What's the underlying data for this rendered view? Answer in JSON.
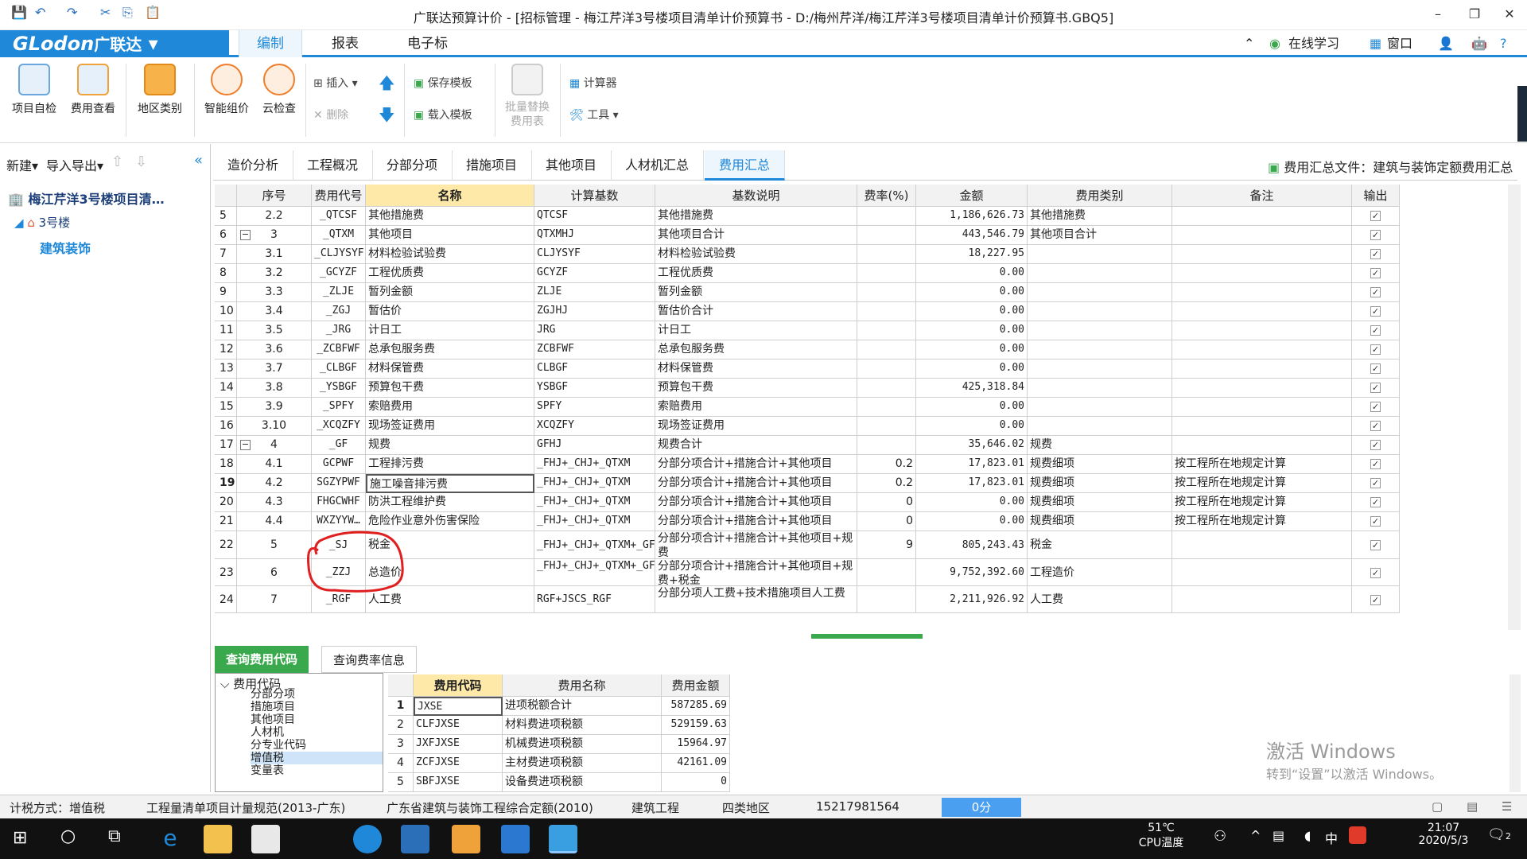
{
  "window": {
    "title": "广联达预算计价 - [招标管理 - 梅江芹洋3号楼项目清单计价预算书 - D:/梅州芹洋/梅江芹洋3号楼项目清单计价预算书.GBQ5]",
    "minimize": "–",
    "restore": "❐",
    "close": "✕"
  },
  "menubar": {
    "logo": "GLodon",
    "logo_cn": "广联达",
    "tabs": [
      "编制",
      "报表",
      "电子标"
    ],
    "right": {
      "online": "在线学习",
      "window": "窗口",
      "help": "?"
    }
  },
  "ribbon": {
    "buttons": [
      "项目自检",
      "费用查看",
      "地区类别",
      "智能组价",
      "云检查"
    ],
    "insert": "插入",
    "delete": "删除",
    "save_template": "保存模板",
    "load_template": "载入模板",
    "batch_replace": "批量替换费用表",
    "calculator": "计算器",
    "tools": "工具"
  },
  "left": {
    "new": "新建",
    "import_export": "导入导出",
    "project": "梅江芹洋3号楼项目清…",
    "building": "3号楼",
    "unit": "建筑装饰"
  },
  "tabs": [
    "造价分析",
    "工程概况",
    "分部分项",
    "措施项目",
    "其他项目",
    "人材机汇总",
    "费用汇总"
  ],
  "tabs_right": "费用汇总文件：建筑与装饰定额费用汇总",
  "grid": {
    "headers": [
      "序号",
      "费用代号",
      "名称",
      "计算基数",
      "基数说明",
      "费率(%)",
      "金额",
      "费用类别",
      "备注",
      "输出"
    ],
    "rows": [
      {
        "r": "5",
        "seq": "2.2",
        "code": "_QTCSF",
        "name": "其他措施费",
        "base": "QTCSF",
        "desc": "其他措施费",
        "rate": "",
        "amt": "1,186,626.73",
        "cat": "其他措施费",
        "note": ""
      },
      {
        "r": "6",
        "seq": "3",
        "code": "_QTXM",
        "name": "其他项目",
        "base": "QTXMHJ",
        "desc": "其他项目合计",
        "rate": "",
        "amt": "443,546.79",
        "cat": "其他项目合计",
        "note": ""
      },
      {
        "r": "7",
        "seq": "3.1",
        "code": "_CLJYSYF",
        "name": "材料检验试验费",
        "base": "CLJYSYF",
        "desc": "材料检验试验费",
        "rate": "",
        "amt": "18,227.95",
        "cat": "",
        "note": ""
      },
      {
        "r": "8",
        "seq": "3.2",
        "code": "_GCYZF",
        "name": "工程优质费",
        "base": "GCYZF",
        "desc": "工程优质费",
        "rate": "",
        "amt": "0.00",
        "cat": "",
        "note": ""
      },
      {
        "r": "9",
        "seq": "3.3",
        "code": "_ZLJE",
        "name": "暂列金额",
        "base": "ZLJE",
        "desc": "暂列金额",
        "rate": "",
        "amt": "0.00",
        "cat": "",
        "note": ""
      },
      {
        "r": "10",
        "seq": "3.4",
        "code": "_ZGJ",
        "name": "暂估价",
        "base": "ZGJHJ",
        "desc": "暂估价合计",
        "rate": "",
        "amt": "0.00",
        "cat": "",
        "note": ""
      },
      {
        "r": "11",
        "seq": "3.5",
        "code": "_JRG",
        "name": "计日工",
        "base": "JRG",
        "desc": "计日工",
        "rate": "",
        "amt": "0.00",
        "cat": "",
        "note": ""
      },
      {
        "r": "12",
        "seq": "3.6",
        "code": "_ZCBFWF",
        "name": "总承包服务费",
        "base": "ZCBFWF",
        "desc": "总承包服务费",
        "rate": "",
        "amt": "0.00",
        "cat": "",
        "note": ""
      },
      {
        "r": "13",
        "seq": "3.7",
        "code": "_CLBGF",
        "name": "材料保管费",
        "base": "CLBGF",
        "desc": "材料保管费",
        "rate": "",
        "amt": "0.00",
        "cat": "",
        "note": ""
      },
      {
        "r": "14",
        "seq": "3.8",
        "code": "_YSBGF",
        "name": "预算包干费",
        "base": "YSBGF",
        "desc": "预算包干费",
        "rate": "",
        "amt": "425,318.84",
        "cat": "",
        "note": ""
      },
      {
        "r": "15",
        "seq": "3.9",
        "code": "_SPFY",
        "name": "索赔费用",
        "base": "SPFY",
        "desc": "索赔费用",
        "rate": "",
        "amt": "0.00",
        "cat": "",
        "note": ""
      },
      {
        "r": "16",
        "seq": "3.10",
        "code": "_XCQZFY",
        "name": "现场签证费用",
        "base": "XCQZFY",
        "desc": "现场签证费用",
        "rate": "",
        "amt": "0.00",
        "cat": "",
        "note": ""
      },
      {
        "r": "17",
        "seq": "4",
        "code": "_GF",
        "name": "规费",
        "base": "GFHJ",
        "desc": "规费合计",
        "rate": "",
        "amt": "35,646.02",
        "cat": "规费",
        "note": ""
      },
      {
        "r": "18",
        "seq": "4.1",
        "code": "GCPWF",
        "name": "工程排污费",
        "base": "_FHJ+_CHJ+_QTXM",
        "desc": "分部分项合计+措施合计+其他项目",
        "rate": "0.2",
        "amt": "17,823.01",
        "cat": "规费细项",
        "note": "按工程所在地规定计算"
      },
      {
        "r": "19",
        "seq": "4.2",
        "code": "SGZYPWF",
        "name": "施工噪音排污费",
        "base": "_FHJ+_CHJ+_QTXM",
        "desc": "分部分项合计+措施合计+其他项目",
        "rate": "0.2",
        "amt": "17,823.01",
        "cat": "规费细项",
        "note": "按工程所在地规定计算"
      },
      {
        "r": "20",
        "seq": "4.3",
        "code": "FHGCWHF",
        "name": "防洪工程维护费",
        "base": "_FHJ+_CHJ+_QTXM",
        "desc": "分部分项合计+措施合计+其他项目",
        "rate": "0",
        "amt": "0.00",
        "cat": "规费细项",
        "note": "按工程所在地规定计算"
      },
      {
        "r": "21",
        "seq": "4.4",
        "code": "WXZYYW…",
        "name": "危险作业意外伤害保险",
        "base": "_FHJ+_CHJ+_QTXM",
        "desc": "分部分项合计+措施合计+其他项目",
        "rate": "0",
        "amt": "0.00",
        "cat": "规费细项",
        "note": "按工程所在地规定计算"
      },
      {
        "r": "22",
        "seq": "5",
        "code": "_SJ",
        "name": "税金",
        "base": "_FHJ+_CHJ+_QTXM+_GF",
        "desc": "分部分项合计+措施合计+其他项目+规费",
        "rate": "9",
        "amt": "805,243.43",
        "cat": "税金",
        "note": ""
      },
      {
        "r": "23",
        "seq": "6",
        "code": "_ZZJ",
        "name": "总造价",
        "base": "_FHJ+_CHJ+_QTXM+_GF+_SJ",
        "desc": "分部分项合计+措施合计+其他项目+规费+税金",
        "rate": "",
        "amt": "9,752,392.60",
        "cat": "工程造价",
        "note": ""
      },
      {
        "r": "24",
        "seq": "7",
        "code": "_RGF",
        "name": "人工费",
        "base": "RGF+JSCS_RGF",
        "desc": "分部分项人工费+技术措施项目人工费",
        "rate": "",
        "amt": "2,211,926.92",
        "cat": "人工费",
        "note": ""
      }
    ]
  },
  "bottom": {
    "tabs": [
      "查询费用代码",
      "查询费率信息"
    ],
    "tree_root": "费用代码",
    "tree_items": [
      "分部分项",
      "措施项目",
      "其他项目",
      "人材机",
      "分专业代码",
      "增值税",
      "变量表"
    ],
    "headers": [
      "费用代码",
      "费用名称",
      "费用金额"
    ],
    "rows": [
      {
        "n": "1",
        "code": "JXSE",
        "name": "进项税额合计",
        "amt": "587285.69"
      },
      {
        "n": "2",
        "code": "CLFJXSE",
        "name": "材料费进项税额",
        "amt": "529159.63"
      },
      {
        "n": "3",
        "code": "JXFJXSE",
        "name": "机械费进项税额",
        "amt": "15964.97"
      },
      {
        "n": "4",
        "code": "ZCFJXSE",
        "name": "主材费进项税额",
        "amt": "42161.09"
      },
      {
        "n": "5",
        "code": "SBFJXSE",
        "name": "设备费进项税额",
        "amt": "0"
      }
    ]
  },
  "watermark": {
    "line1": "激活 Windows",
    "line2": "转到“设置”以激活 Windows。"
  },
  "status": {
    "tax": "计税方式：增值税",
    "spec": "工程量清单项目计量规范(2013-广东)",
    "quota": "广东省建筑与装饰工程综合定额(2010)",
    "kind": "建筑工程",
    "region": "四类地区",
    "phone": "15217981564",
    "score": "0分"
  },
  "taskbar": {
    "temp": "51℃",
    "temp_label": "CPU温度",
    "ime": "中",
    "time": "21:07",
    "date": "2020/5/3",
    "notify": "2"
  }
}
